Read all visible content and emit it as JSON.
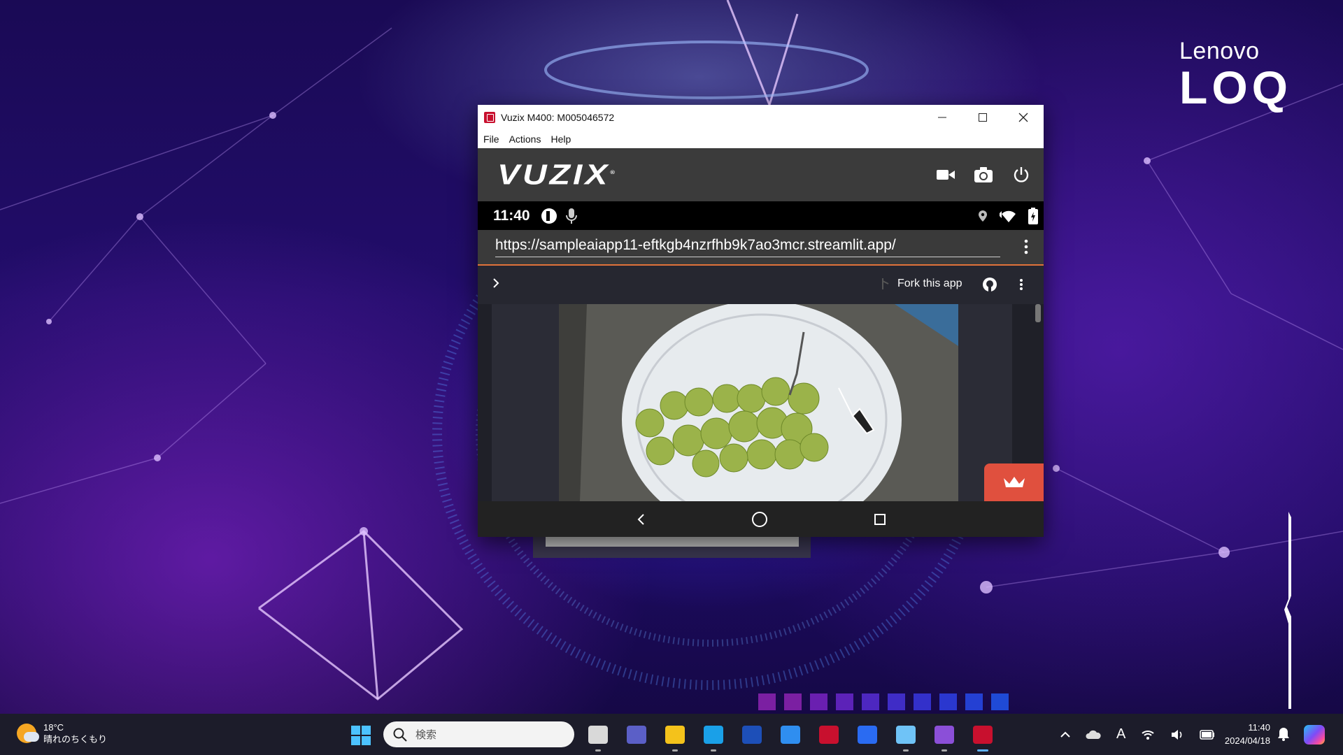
{
  "desktop": {
    "brand": "Lenovo",
    "sub_brand": "LOQ"
  },
  "window": {
    "title": "Vuzix M400: M005046572",
    "menu": [
      "File",
      "Actions",
      "Help"
    ],
    "vuzix_logo": "VUZIX",
    "vuzix_reg": "®"
  },
  "device": {
    "time": "11:40",
    "url": "https://sampleaiapp11-eftkgb4nzrfhb9k7ao3mcr.streamlit.app/"
  },
  "streamlit": {
    "fork_label": "Fork this app"
  },
  "taskbar": {
    "weather_temp": "18°C",
    "weather_desc": "晴れのちくもり",
    "search_placeholder": "検索",
    "clock_time": "11:40",
    "clock_date": "2024/04/18",
    "ime": "A",
    "apps": [
      {
        "name": "task-view",
        "color": "#d9d9d9"
      },
      {
        "name": "teams",
        "color": "#5b5fc7"
      },
      {
        "name": "file-explorer",
        "color": "#f4c21b"
      },
      {
        "name": "edge",
        "color": "#1aa0e8"
      },
      {
        "name": "lenovo-l",
        "color": "#1d4fb8"
      },
      {
        "name": "app-a",
        "color": "#2f8ef0"
      },
      {
        "name": "mcafee",
        "color": "#c8102e"
      },
      {
        "name": "power-automate",
        "color": "#2a6bf2"
      },
      {
        "name": "notepad",
        "color": "#6fc3f7"
      },
      {
        "name": "visual-studio",
        "color": "#8b4fd8"
      },
      {
        "name": "vuzix-view",
        "color": "#c8102e"
      }
    ]
  },
  "colors": {
    "accent_orange": "#e0733a",
    "streamlit_dark": "#262730",
    "crown_button": "#e0503e",
    "squares": [
      "#7b1fa2",
      "#7b1fa2",
      "#6a1fb0",
      "#5c22b8",
      "#4d27c0",
      "#3f2cc6",
      "#3330ca",
      "#2a37cf",
      "#2440d3",
      "#1f4ad6"
    ]
  }
}
